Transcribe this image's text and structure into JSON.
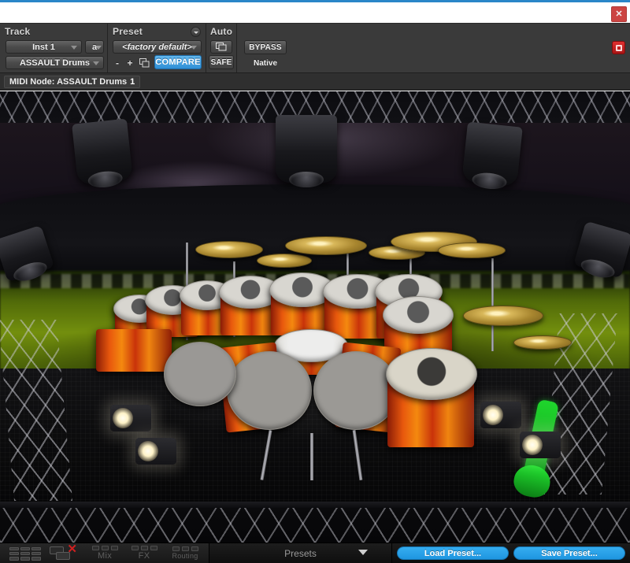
{
  "window": {
    "close_label": "✕",
    "accent_color": "#2a86c8",
    "close_color": "#cc4442"
  },
  "header": {
    "track": {
      "title": "Track",
      "instrument": "Inst 1",
      "plugin": "ASSAULT Drums",
      "channel": "a"
    },
    "preset": {
      "title": "Preset",
      "name": "<factory default>",
      "minus_label": "-",
      "plus_label": "+",
      "copy_icon": "copy-icon",
      "compare_label": "COMPARE",
      "compare_color": "#2f8fd6",
      "menu_icon": "chevron-down-circle-icon"
    },
    "auto": {
      "title": "Auto",
      "write_icon": "automation-write-icon",
      "safe_label": "SAFE"
    },
    "plugin_state": {
      "bypass_label": "BYPASS",
      "native_label": "Native",
      "record_icon": "record-enable-icon",
      "record_color": "#c11a1a"
    },
    "midi": {
      "prefix": "MIDI Node: ASSAULT Drums",
      "node_number": "1"
    }
  },
  "stage": {
    "name": "assault-drums-stage-artwork",
    "description": "Stadium stage photo with drum kit, cymbals, moving-head lights, truss towers and green guitar"
  },
  "bottombar": {
    "grid_icon": "grid-view-icon",
    "layers_icon": "layers-close-icon",
    "tabs": [
      {
        "label": "Mix",
        "name": "tab-mix"
      },
      {
        "label": "FX",
        "name": "tab-fx"
      },
      {
        "label": "Routing",
        "name": "tab-routing"
      }
    ],
    "presets_label": "Presets",
    "presets_chevron": "chevron-down-icon",
    "load_label": "Load Preset...",
    "save_label": "Save Preset...",
    "button_color": "#1f96e0"
  }
}
